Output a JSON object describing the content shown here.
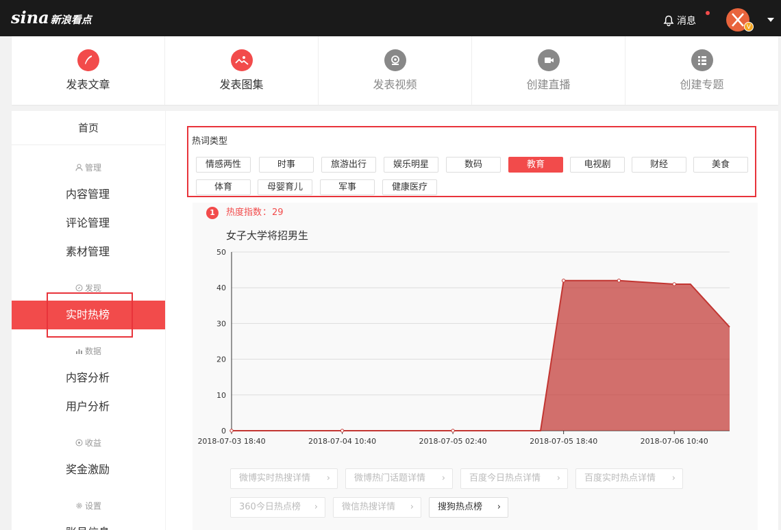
{
  "header": {
    "logo_main": "sina",
    "logo_sub": "新浪看点",
    "messages_label": "消息",
    "avatar_badge": "V"
  },
  "actions": [
    {
      "label": "发表文章",
      "icon": "quill-icon",
      "enabled": true
    },
    {
      "label": "发表图集",
      "icon": "image-icon",
      "enabled": true
    },
    {
      "label": "发表视频",
      "icon": "video-icon",
      "enabled": false
    },
    {
      "label": "创建直播",
      "icon": "live-icon",
      "enabled": false
    },
    {
      "label": "创建专题",
      "icon": "topic-icon",
      "enabled": false
    }
  ],
  "sidebar": {
    "home": "首页",
    "groups": {
      "manage": "管理",
      "discover": "发现",
      "data": "数据",
      "income": "收益",
      "settings": "设置"
    },
    "items": {
      "content_manage": "内容管理",
      "comment_manage": "评论管理",
      "material_manage": "素材管理",
      "realtime_hot": "实时热榜",
      "content_analysis": "内容分析",
      "user_analysis": "用户分析",
      "bonus": "奖金激励",
      "account_info": "账号信息"
    }
  },
  "hotword": {
    "title": "热词类型",
    "tags": [
      "情感两性",
      "时事",
      "旅游出行",
      "娱乐明星",
      "数码",
      "教育",
      "电视剧",
      "财经",
      "美食",
      "体育",
      "母婴育儿",
      "军事",
      "健康医疗"
    ],
    "active": "教育"
  },
  "hot_item": {
    "rank": "1",
    "heat_label": "热度指数",
    "heat_sep": "：",
    "heat_value": "29",
    "title": "女子大学将招男生"
  },
  "chart_data": {
    "type": "area",
    "x": [
      "2018-07-03 18:40",
      "2018-07-04 10:40",
      "2018-07-05 02:40",
      "2018-07-05 15:20",
      "2018-07-05 18:40",
      "2018-07-06 02:40",
      "2018-07-06 10:40",
      "2018-07-06 13:00",
      "2018-07-06 18:40"
    ],
    "values": [
      0,
      0,
      0,
      0,
      42,
      42,
      41,
      41,
      29
    ],
    "x_ticks": [
      "2018-07-03 18:40",
      "2018-07-04 10:40",
      "2018-07-05 02:40",
      "2018-07-05 18:40",
      "2018-07-06 10:40"
    ],
    "y_ticks": [
      0,
      10,
      20,
      30,
      40,
      50
    ],
    "ylim": [
      0,
      50
    ],
    "grid": true,
    "color": "#c23531"
  },
  "links": [
    {
      "label": "微博实时热搜详情",
      "enabled": false
    },
    {
      "label": "微博热门话题详情",
      "enabled": false
    },
    {
      "label": "百度今日热点详情",
      "enabled": false
    },
    {
      "label": "百度实时热点详情",
      "enabled": false
    },
    {
      "label": "360今日热点榜",
      "enabled": false
    },
    {
      "label": "微信热搜详情",
      "enabled": false
    },
    {
      "label": "搜狗热点榜",
      "enabled": true
    }
  ]
}
